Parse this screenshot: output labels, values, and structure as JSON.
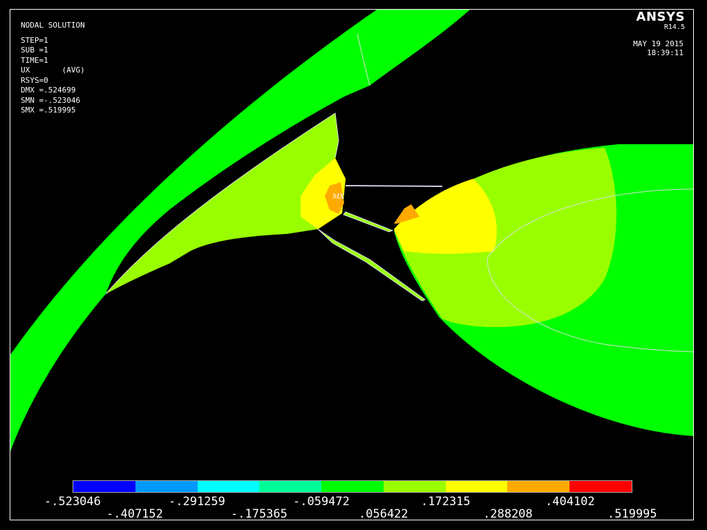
{
  "info": {
    "lines": [
      "NODAL SOLUTION",
      "",
      "STEP=1",
      "SUB =1",
      "TIME=1",
      "UX       (AVG)",
      "RSYS=0",
      "DMX =.524699",
      "SMN =-.523046",
      "SMX =.519995"
    ]
  },
  "brand": {
    "name": "ANSYS",
    "version": "R14.5"
  },
  "timestamp": {
    "date": "MAY 19 2015",
    "time": "18:39:11"
  },
  "marker": {
    "label": "MX"
  },
  "legend": {
    "colors": [
      "#0000ff",
      "#0099ff",
      "#00ffff",
      "#00ff99",
      "#00ff00",
      "#99ff00",
      "#ffff00",
      "#ffaa00",
      "#ff0000"
    ],
    "ticks_top": [
      "-.523046",
      "-.291259",
      "-.059472",
      ".172315",
      ".404102"
    ],
    "ticks_bottom": [
      "-.407152",
      "-.175365",
      ".056422",
      ".288208",
      ".519995"
    ]
  }
}
